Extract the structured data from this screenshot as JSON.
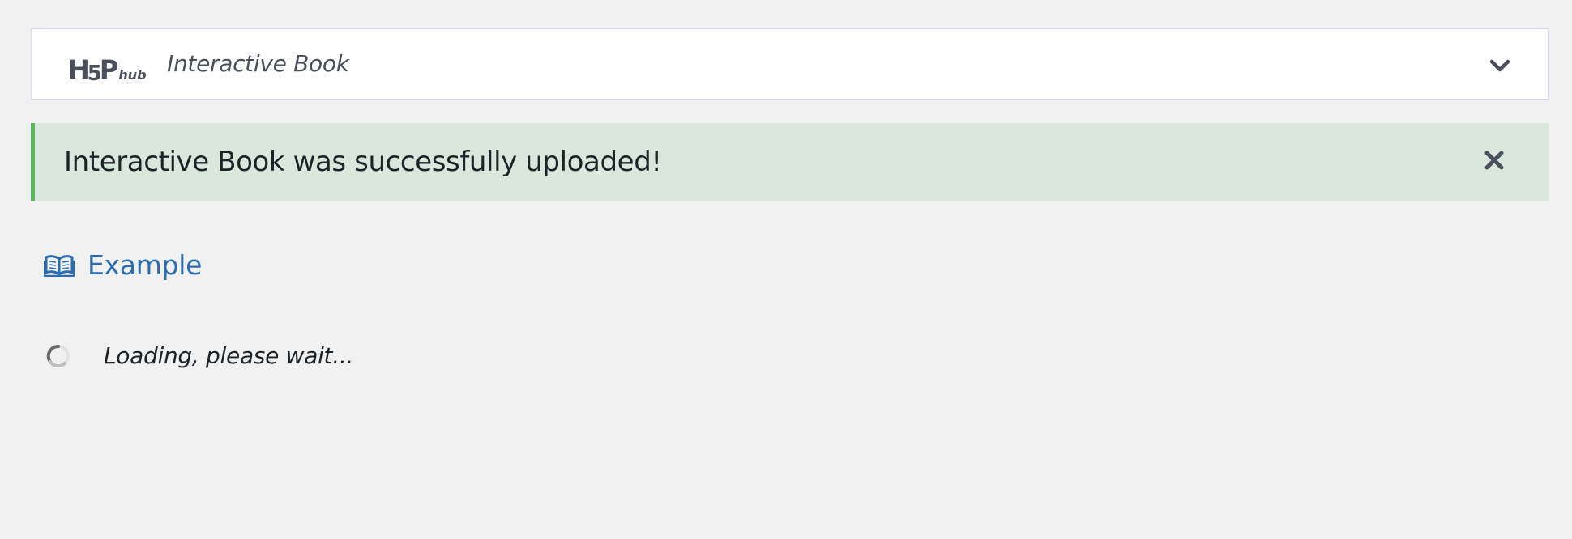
{
  "hub": {
    "logo_main": "H5P",
    "logo_sub": "hub",
    "selected_content_type": "Interactive Book",
    "toggle_icon": "chevron-down-icon"
  },
  "notice": {
    "message": "Interactive Book was successfully uploaded!",
    "close_icon": "close-icon",
    "accent_color": "#5cb85c",
    "background_color": "#d9e7dd"
  },
  "content": {
    "icon": "book-open-icon",
    "title": "Example",
    "link_color": "#2c6cb0"
  },
  "loading": {
    "icon": "spinner-icon",
    "message": "Loading, please wait..."
  }
}
